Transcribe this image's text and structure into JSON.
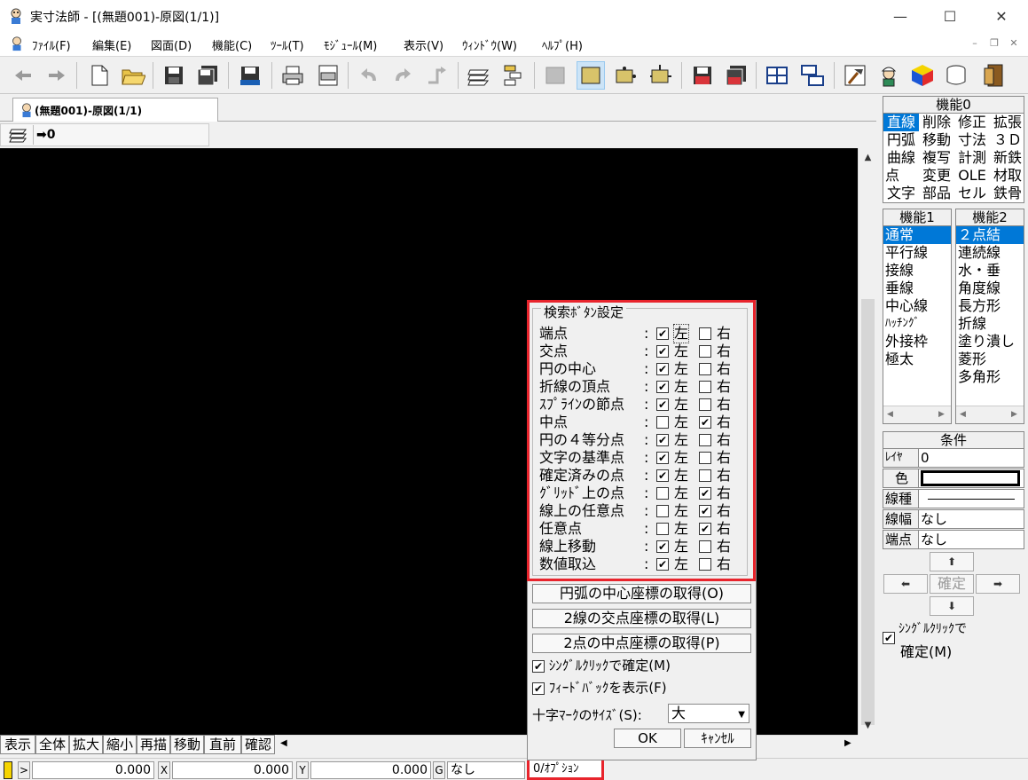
{
  "window": {
    "title": "実寸法師 - [(無題001)-原図(1/1)]",
    "app_icon": "app-mascot-icon"
  },
  "menu": [
    "ﾌｧｲﾙ(F)",
    "編集(E)",
    "図面(D)",
    "機能(C)",
    "ﾂｰﾙ(T)",
    "ﾓｼﾞｭｰﾙ(M)",
    "表示(V)",
    "ｳｨﾝﾄﾞｳ(W)",
    "ﾍﾙﾌﾟ(H)"
  ],
  "toolbar": {
    "icons": [
      "back-arrow-icon",
      "forward-arrow-icon",
      "new-file-icon",
      "open-folder-icon",
      "save-icon",
      "save-all-icon",
      "save-as-icon",
      "print-icon",
      "print-preview-icon",
      "undo-icon",
      "redo-icon",
      "redo-arrow-icon",
      "layer-icon",
      "layer-switch-icon",
      "grid-icon",
      "snap-grid-icon",
      "snap-point-icon",
      "snap-intersection-icon",
      "red-save-icon",
      "red-save-all-icon",
      "table-icon",
      "window-split-icon",
      "tools-icon",
      "worker-icon",
      "color-cube-icon",
      "cylinder-icon",
      "exit-door-icon"
    ]
  },
  "doc_tab": {
    "label": "(無題001)-原図(1/1)"
  },
  "layer_strip": {
    "value": "0"
  },
  "function_panel": {
    "header": "機能0",
    "cells": [
      [
        "直線",
        "削除",
        "修正",
        "拡張"
      ],
      [
        "円弧",
        "移動",
        "寸法",
        "３Ｄ"
      ],
      [
        "曲線",
        "複写",
        "計測",
        "新鉄"
      ],
      [
        "点",
        "変更",
        "OLE",
        "材取"
      ],
      [
        "文字",
        "部品",
        "セル",
        "鉄骨"
      ]
    ],
    "selected": "直線"
  },
  "function1": {
    "header": "機能1",
    "items": [
      "通常",
      "平行線",
      "接線",
      "垂線",
      "中心線",
      "ﾊｯﾁﾝｸﾞ",
      "外接枠",
      "極太"
    ],
    "selected": "通常"
  },
  "function2": {
    "header": "機能2",
    "items": [
      "２点結",
      "連続線",
      "水・垂",
      "角度線",
      "長方形",
      "折線",
      "塗り潰し",
      "菱形",
      "多角形"
    ],
    "selected": "２点結"
  },
  "condition": {
    "header": "条件",
    "rows": [
      {
        "label": "ﾚｲﾔ",
        "value": "0"
      },
      {
        "label": "色",
        "value": ""
      },
      {
        "label": "線種",
        "value": ""
      },
      {
        "label": "線幅",
        "value": "なし"
      },
      {
        "label": "端点",
        "value": "なし"
      }
    ],
    "confirm_label": "確定",
    "single_click": {
      "label1": "ｼﾝｸﾞﾙｸﾘｯｸで",
      "label2": "確定(M)",
      "checked": true
    }
  },
  "dialog": {
    "group_title": "検索ﾎﾞﾀﾝ設定",
    "colon": ":",
    "left_label": "左",
    "right_label": "右",
    "rows": [
      {
        "label": "端点",
        "left": true,
        "right": false
      },
      {
        "label": "交点",
        "left": true,
        "right": false
      },
      {
        "label": "円の中心",
        "left": true,
        "right": false
      },
      {
        "label": "折線の頂点",
        "left": true,
        "right": false
      },
      {
        "label": "ｽﾌﾟﾗｲﾝの節点",
        "left": true,
        "right": false
      },
      {
        "label": "中点",
        "left": false,
        "right": true
      },
      {
        "label": "円の４等分点",
        "left": true,
        "right": false
      },
      {
        "label": "文字の基準点",
        "left": true,
        "right": false
      },
      {
        "label": "確定済みの点",
        "left": true,
        "right": false
      },
      {
        "label": "ｸﾞﾘｯﾄﾞ上の点",
        "left": false,
        "right": true
      },
      {
        "label": "線上の任意点",
        "left": false,
        "right": true
      },
      {
        "label": "任意点",
        "left": false,
        "right": true
      },
      {
        "label": "線上移動",
        "left": true,
        "right": false
      },
      {
        "label": "数値取込",
        "left": true,
        "right": false
      }
    ],
    "buttons": [
      "円弧の中心座標の取得(O)",
      "2線の交点座標の取得(L)",
      "2点の中点座標の取得(P)"
    ],
    "check_single_click": "ｼﾝｸﾞﾙｸﾘｯｸで確定(M)",
    "check_feedback": "ﾌｨｰﾄﾞﾊﾞｯｸを表示(F)",
    "size_label": "十字ﾏｰｸのｻｲｽﾞ(S):",
    "size_value": "大",
    "ok": "OK",
    "cancel": "ｷｬﾝｾﾙ"
  },
  "command_row": [
    "表示",
    "全体",
    "拡大",
    "縮小",
    "再描",
    "移動",
    "直前",
    "確認"
  ],
  "status": {
    "mode_label": ">",
    "value1": "0.000",
    "x_label": "X",
    "x_value": "0.000",
    "y_label": "Y",
    "y_value": "0.000",
    "g_label": "G",
    "g_value": "なし",
    "option": "0/ｵﾌﾟｼｮﾝ"
  }
}
